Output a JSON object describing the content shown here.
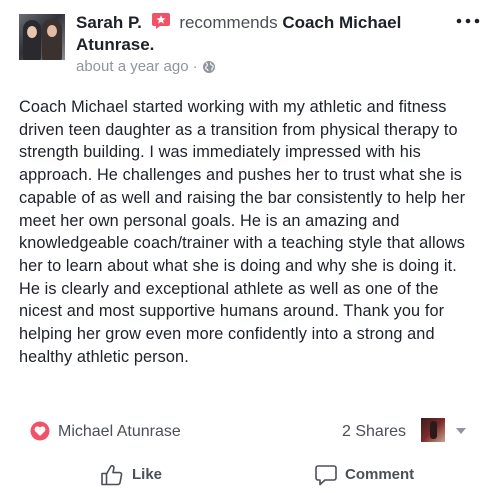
{
  "post": {
    "author": "Sarah P.",
    "action_text": "recommends",
    "page_name": "Coach Michael Atunrase.",
    "timestamp": "about a year ago",
    "separator": "·",
    "privacy_icon": "globe-icon",
    "more_icon": "more-horizontal-icon"
  },
  "review": {
    "body": "Coach Michael started working with my athletic and fitness driven teen daughter as a transition from physical therapy to strength building. I was immediately impressed with his approach. He challenges and pushes her to trust what she is capable of as well and raising the bar consistently to help her meet her own personal goals. He is an amazing and knowledgeable coach/trainer with a teaching style that allows her to learn about what she is doing and why she is doing it. He is clearly and exceptional athlete as well as one of the nicest and most supportive humans around. Thank you for helping her grow even more confidently into a strong and healthy athletic person."
  },
  "stats": {
    "page_name": "Michael Atunrase",
    "shares": "2 Shares",
    "heart_icon": "heart-icon",
    "caret_icon": "caret-down-icon"
  },
  "actions": {
    "like_label": "Like",
    "comment_label": "Comment"
  },
  "colors": {
    "recommend_badge": "#f25268",
    "text": "#1d2129",
    "secondary": "#90949c",
    "action": "#4b4f56"
  }
}
